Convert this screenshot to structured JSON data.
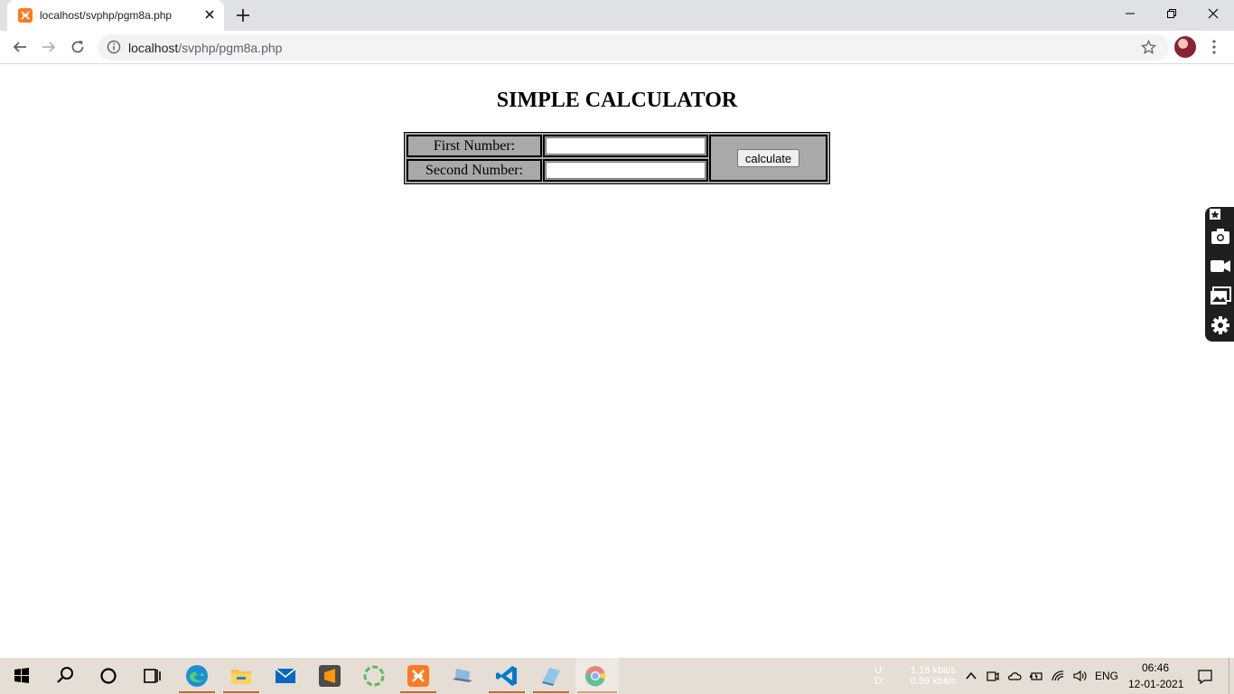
{
  "browser": {
    "tab": {
      "title": "localhost/svphp/pgm8a.php",
      "favicon": "xampp-icon"
    },
    "address_bar": {
      "host": "localhost",
      "path": "/svphp/pgm8a.php"
    }
  },
  "page": {
    "heading": "SIMPLE CALCULATOR",
    "form": {
      "first_label": "First Number:",
      "first_value": "",
      "second_label": "Second Number:",
      "second_value": "",
      "button_label": "calculate"
    }
  },
  "side_widget": {
    "icons": [
      "pin-icon",
      "camera-icon",
      "video-icon",
      "gallery-icon",
      "settings-icon"
    ]
  },
  "taskbar": {
    "apps": [
      "start-icon",
      "search-icon",
      "cortana-icon",
      "task-view-icon",
      "edge-icon",
      "file-explorer-icon",
      "mail-icon",
      "sublime-text-icon",
      "sync-icon",
      "xampp-icon",
      "laptop-icon",
      "vscode-icon",
      "notepad-icon",
      "chrome-icon"
    ],
    "net_up_label": "U:",
    "net_down_label": "D:",
    "net_up_value": "1.18 kbit/s",
    "net_down_value": "0.59 kbit/s",
    "language": "ENG",
    "time": "06:46",
    "date": "12-01-2021"
  },
  "colors": {
    "accent": "#c9662b",
    "table_bg": "#a9a9a9"
  }
}
